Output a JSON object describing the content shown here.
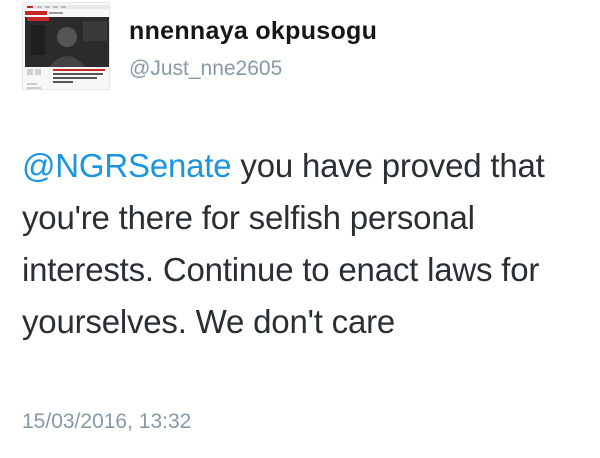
{
  "user": {
    "display_name": "nnennaya okpusogu",
    "handle": "@Just_nne2605",
    "avatar_icon": "profile-photo-icon"
  },
  "tweet": {
    "mention": "@NGRSenate",
    "body": " you have proved that you're there for selfish personal interests. Continue to enact laws for yourselves. We don't care",
    "timestamp": "15/03/2016, 13:32"
  },
  "colors": {
    "mention": "#1b95e0",
    "secondary_text": "#8899a6",
    "primary_text": "#292f33"
  }
}
